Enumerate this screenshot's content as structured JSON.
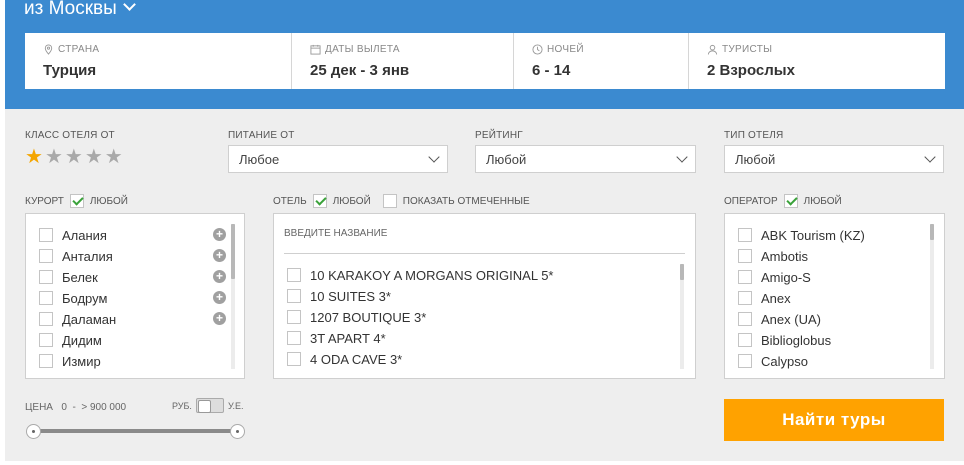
{
  "header": {
    "from": "из Москвы"
  },
  "params": [
    {
      "label": "Страна",
      "value": "Турция",
      "icon": "location-pin-icon"
    },
    {
      "label": "Даты вылета",
      "value": "25 дек - 3 янв",
      "icon": "calendar-icon"
    },
    {
      "label": "Ночей",
      "value": "6 - 14",
      "icon": "clock-icon"
    },
    {
      "label": "Туристы",
      "value": "2 Взрослых",
      "icon": "user-icon"
    }
  ],
  "filters": {
    "hotel_class_label": "Класс отеля от",
    "hotel_class_selected": 1,
    "hotel_class_max": 5,
    "meal_label": "Питание от",
    "meal_value": "Любое",
    "rating_label": "Рейтинг",
    "rating_value": "Любой",
    "hotel_type_label": "Тип отеля",
    "hotel_type_value": "Любой",
    "resort_label": "Курорт",
    "resort_any": "Любой",
    "resorts": [
      "Алания",
      "Анталия",
      "Белек",
      "Бодрум",
      "Даламан",
      "Дидим",
      "Измир"
    ],
    "hotel_label": "Отель",
    "hotel_any": "Любой",
    "show_marked": "Показать отмеченные",
    "hotel_search_placeholder": "Введите название",
    "hotels": [
      "10 KARAKOY A MORGANS ORIGINAL 5*",
      "10 SUITES 3*",
      "1207 BOUTIQUE 3*",
      "3T APART 4*",
      "4 ODA CAVE 3*"
    ],
    "operator_label": "Оператор",
    "operator_any": "Любой",
    "operators": [
      "ABK Tourism (KZ)",
      "Ambotis",
      "Amigo-S",
      "Anex",
      "Anex (UA)",
      "Biblioglobus",
      "Calypso"
    ],
    "price_label": "Цена",
    "price_from": "0",
    "price_dash": "-",
    "price_to": "> 900 000",
    "currency_rub": "руб.",
    "currency_ue": "у.е.",
    "search_button": "Найти туры"
  },
  "colors": {
    "header_bg": "#3b8ad0",
    "button_bg": "#ffa200",
    "star_active": "#f4a500",
    "check": "#3aa23a"
  }
}
